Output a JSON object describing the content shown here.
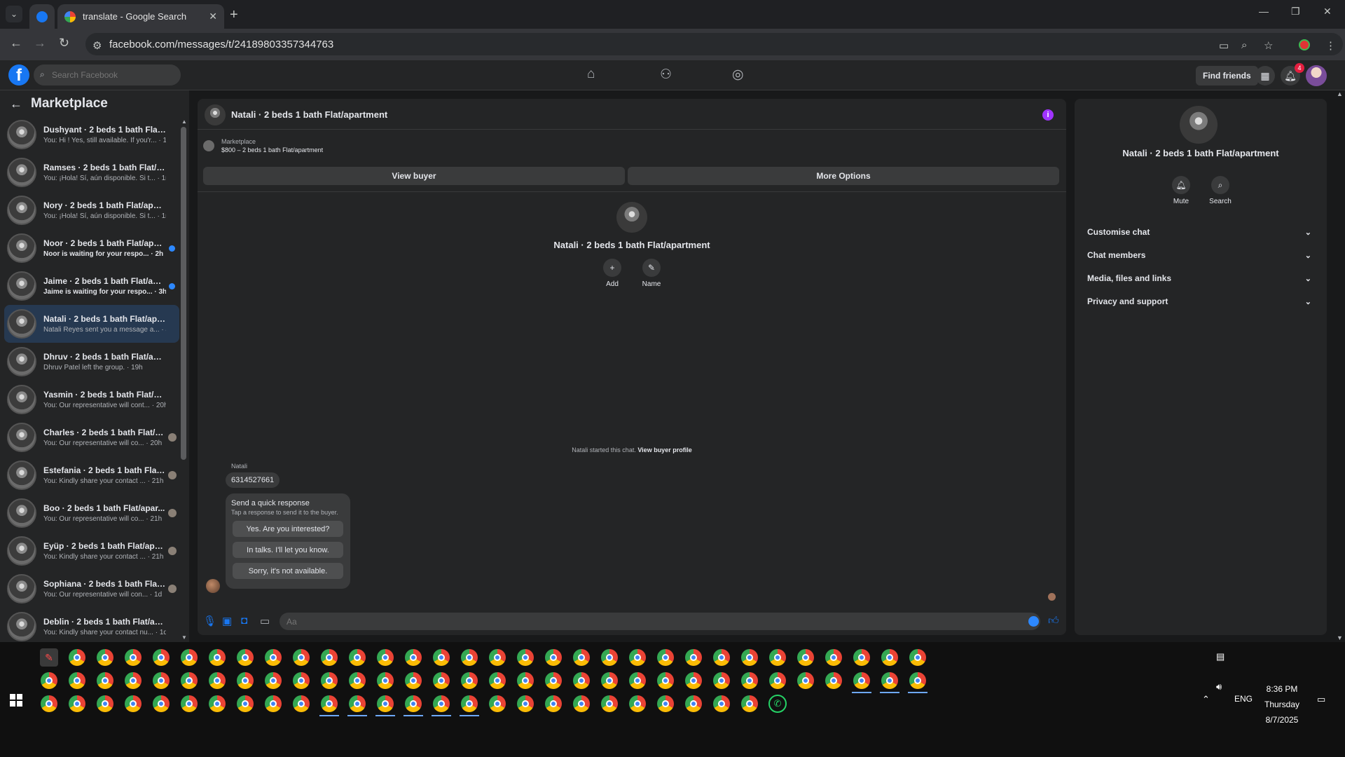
{
  "browser": {
    "tabs": [
      {
        "title": "",
        "active": false,
        "favicon": "facebook-favicon"
      },
      {
        "title": "translate - Google Search",
        "active": true,
        "favicon": "google-favicon"
      }
    ],
    "url": "facebook.com/messages/t/24189803357344763",
    "icons": {
      "back": "←",
      "forward": "→",
      "reload": "↻",
      "site_info": "⚙",
      "cast": "▭",
      "zoom": "⌕",
      "star": "☆",
      "menu": "⋮",
      "minimize": "—",
      "restore": "❐",
      "close": "✕",
      "new_tab": "+",
      "tab_close": "✕",
      "tab_menu": "⌄"
    }
  },
  "facebook": {
    "search_placeholder": "Search Facebook",
    "find_friends": "Find friends",
    "notification_count": "4",
    "nav_icons": [
      "home-icon",
      "friends-icon",
      "groups-icon"
    ],
    "accent": "#1877f2"
  },
  "sidebar": {
    "title": "Marketplace",
    "conversations": [
      {
        "name": "Dushyant · 2 beds 1 bath Flat/a...",
        "preview": "You: Hi ! Yes, still available. If you'r... · 1m",
        "unread": false,
        "indicator": "none"
      },
      {
        "name": "Ramses · 2 beds 1 bath Flat/apa...",
        "preview": "You: ¡Hola! Sí, aún disponible. Si t... · 1m",
        "unread": false,
        "indicator": "none"
      },
      {
        "name": "Nory · 2 beds 1 bath Flat/apart...",
        "preview": "You: ¡Hola! Sí, aún disponible. Si t... · 1m",
        "unread": false,
        "indicator": "none"
      },
      {
        "name": "Noor · 2 beds 1 bath Flat/apar...",
        "preview": "Noor is waiting for your respo... · 2h",
        "unread": true,
        "indicator": "dot"
      },
      {
        "name": "Jaime · 2 beds 1 bath Flat/apa...",
        "preview": "Jaime is waiting for your respo... · 3h",
        "unread": true,
        "indicator": "dot"
      },
      {
        "name": "Natali · 2 beds 1 bath Flat/apart...",
        "preview": "Natali Reyes sent you a message a... · 4h",
        "unread": false,
        "indicator": "none",
        "active": true
      },
      {
        "name": "Dhruv · 2 beds 1 bath Flat/apart...",
        "preview": "Dhruv Patel left the group. · 19h",
        "unread": false,
        "indicator": "none"
      },
      {
        "name": "Yasmin · 2 beds 1 bath Flat/apar...",
        "preview": "You: Our representative will cont... · 20h",
        "unread": false,
        "indicator": "none"
      },
      {
        "name": "Charles · 2 beds 1 bath Flat/a...",
        "preview": "You: Our representative will co... · 20h",
        "unread": false,
        "indicator": "avatar"
      },
      {
        "name": "Estefania · 2 beds 1 bath Flat/...",
        "preview": "You: Kindly share your contact ... · 21h",
        "unread": false,
        "indicator": "avatar"
      },
      {
        "name": "Boo · 2 beds 1 bath Flat/apar...",
        "preview": "You: Our representative will co... · 21h",
        "unread": false,
        "indicator": "avatar"
      },
      {
        "name": "Eyüp · 2 beds 1 bath Flat/apa...",
        "preview": "You: Kindly share your contact ... · 21h",
        "unread": false,
        "indicator": "avatar"
      },
      {
        "name": "Sophiana · 2 beds 1 bath Flat...",
        "preview": "You: Our representative will con... · 1d",
        "unread": false,
        "indicator": "avatar"
      },
      {
        "name": "Deblin · 2 beds 1 bath Flat/apar...",
        "preview": "You: Kindly share your contact nu... · 1d",
        "unread": false,
        "indicator": "none"
      }
    ]
  },
  "chat": {
    "title": "Natali · 2 beds 1 bath Flat/apartment",
    "listing_label": "Marketplace",
    "listing": "$800 – 2 beds 1 bath Flat/apartment",
    "view_buyer": "View buyer",
    "more_options": "More Options",
    "profile_name": "Natali · 2 beds 1 bath Flat/apartment",
    "add_label": "Add",
    "name_label": "Name",
    "started_text": "Natali started this chat.",
    "view_buyer_profile": "View buyer profile",
    "sender": "Natali",
    "message": "6314527661",
    "quick_response_title": "Send a quick response",
    "quick_response_sub": "Tap a response to send it to the buyer.",
    "quick_responses": [
      "Yes. Are you interested?",
      "In talks. I'll let you know.",
      "Sorry, it's not available."
    ],
    "composer_placeholder": "Aa"
  },
  "details": {
    "title": "Natali · 2 beds 1 bath Flat/apartment",
    "mute": "Mute",
    "search": "Search",
    "sections": [
      "Customise chat",
      "Chat members",
      "Media, files and links",
      "Privacy and support"
    ]
  },
  "taskbar": {
    "time": "8:36 PM",
    "day": "Thursday",
    "date": "8/7/2025",
    "language": "ENG"
  }
}
